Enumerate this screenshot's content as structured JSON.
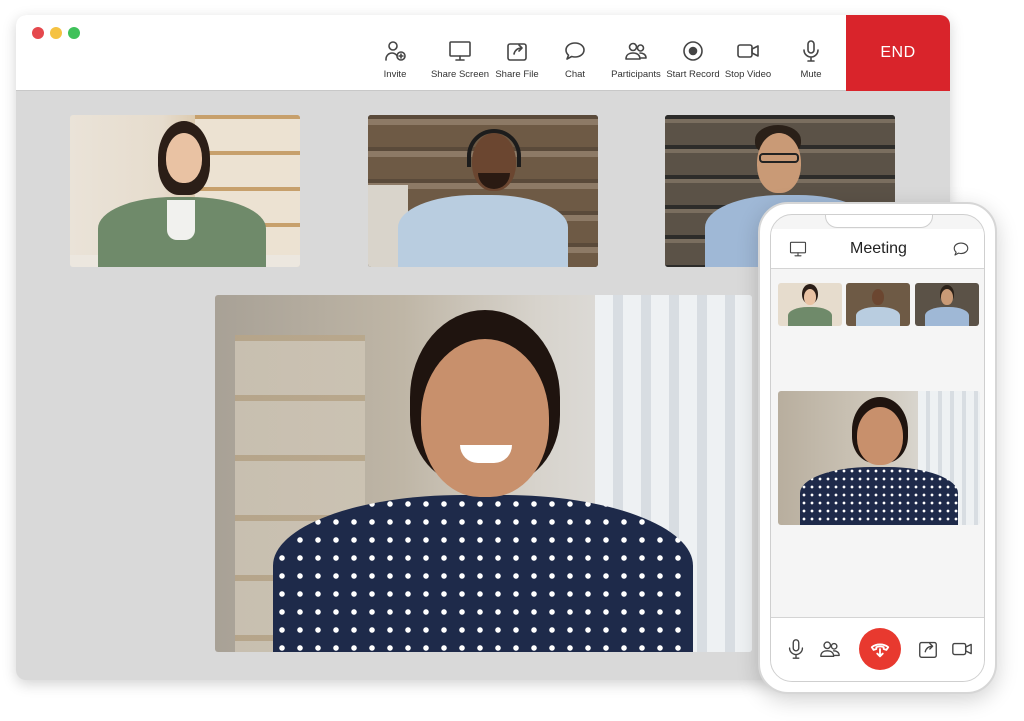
{
  "window": {
    "controls": {
      "close_color": "#e5484d",
      "minimize_color": "#f5c242",
      "maximize_color": "#3fc15a"
    },
    "toolbar": [
      {
        "id": "invite",
        "label": "Invite",
        "icon": "add-user-icon"
      },
      {
        "id": "share-screen",
        "label": "Share Screen",
        "icon": "monitor-icon"
      },
      {
        "id": "share-file",
        "label": "Share File",
        "icon": "share-file-icon"
      },
      {
        "id": "chat",
        "label": "Chat",
        "icon": "chat-bubble-icon"
      },
      {
        "id": "participants",
        "label": "Participants",
        "icon": "people-icon"
      },
      {
        "id": "start-record",
        "label": "Start Record",
        "icon": "record-icon"
      },
      {
        "id": "stop-video",
        "label": "Stop Video",
        "icon": "video-camera-icon"
      },
      {
        "id": "mute",
        "label": "Mute",
        "icon": "microphone-icon"
      }
    ],
    "end_label": "END",
    "end_color": "#d9242b"
  },
  "phone": {
    "title": "Meeting",
    "header_left_icon": "monitor-icon",
    "header_right_icon": "chat-bubble-icon",
    "bottom_icons": [
      "microphone-icon",
      "people-icon",
      "hang-up-icon",
      "share-file-icon",
      "video-camera-icon"
    ],
    "hangup_color": "#e8392f"
  },
  "participants": [
    {
      "id": "woman-green-cardigan",
      "shirt": "#6f8a6a",
      "skin": "#e9c2a3",
      "hair": "#2b1e17"
    },
    {
      "id": "man-headphones",
      "shirt": "#b9cde0",
      "skin": "#6b4630",
      "hair": "#1a1a1a"
    },
    {
      "id": "man-glasses-denim",
      "shirt": "#9fb8d6",
      "skin": "#c99a76",
      "hair": "#2a2018"
    },
    {
      "id": "woman-polka-dot",
      "shirt": "#1e2a4a",
      "skin": "#c8906c",
      "hair": "#1f140f"
    }
  ]
}
